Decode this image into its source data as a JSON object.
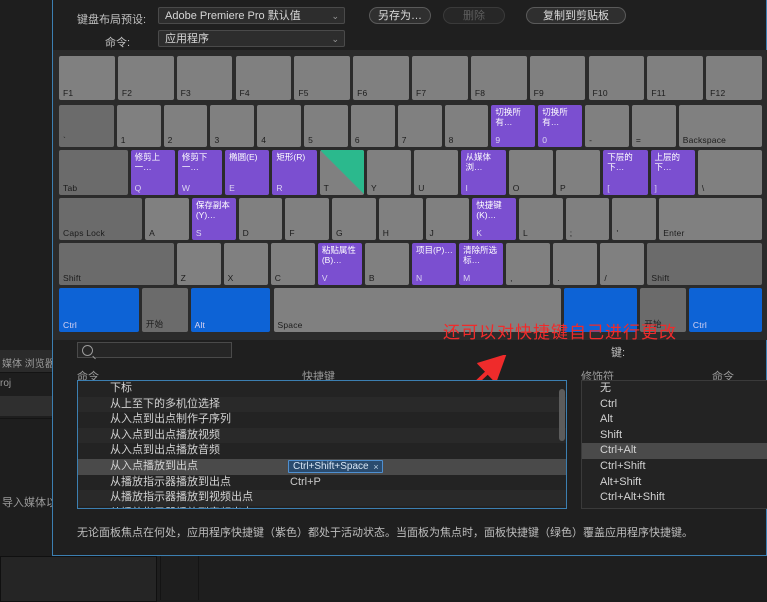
{
  "background": {
    "tabs": [
      "媒体 浏览器"
    ],
    "project_label": "roj",
    "import_hint": "导入媒体以开",
    "effects_label": "媒体 浏览器"
  },
  "dialog": {
    "preset_label": "键盘布局预设:",
    "preset_value": "Adobe Premiere Pro 默认值",
    "save_as_label": "另存为…",
    "delete_label": "删除",
    "copy_clipboard_label": "复制到剪贴板",
    "command_label": "命令:",
    "command_value": "应用程序",
    "caret": "⌄"
  },
  "annotation": {
    "red_text": "还可以对快捷键自己进行更改"
  },
  "keyboard": {
    "function_row": [
      {
        "name": "F1"
      },
      {
        "name": "F2"
      },
      {
        "name": "F3"
      },
      {
        "name": "F4"
      },
      {
        "name": "F5"
      },
      {
        "name": "F6"
      },
      {
        "name": "F7"
      },
      {
        "name": "F8"
      },
      {
        "name": "F9"
      },
      {
        "name": "F10"
      },
      {
        "name": "F11"
      },
      {
        "name": "F12"
      }
    ],
    "number_row": [
      {
        "name": "`",
        "cmd": "",
        "style": "dark"
      },
      {
        "name": "1",
        "cmd": "",
        "style": ""
      },
      {
        "name": "2",
        "cmd": "",
        "style": ""
      },
      {
        "name": "3",
        "cmd": "",
        "style": ""
      },
      {
        "name": "4",
        "cmd": "",
        "style": ""
      },
      {
        "name": "5",
        "cmd": "",
        "style": ""
      },
      {
        "name": "6",
        "cmd": "",
        "style": ""
      },
      {
        "name": "7",
        "cmd": "",
        "style": ""
      },
      {
        "name": "8",
        "cmd": "",
        "style": ""
      },
      {
        "name": "9",
        "cmd": "切换所有…",
        "style": "purple"
      },
      {
        "name": "0",
        "cmd": "切换所有…",
        "style": "purple"
      },
      {
        "name": "-",
        "cmd": "",
        "style": ""
      },
      {
        "name": "=",
        "cmd": "",
        "style": ""
      },
      {
        "name": "Backspace",
        "cmd": "",
        "style": ""
      }
    ],
    "tab_row": [
      {
        "name": "Tab",
        "cmd": "",
        "style": "dark"
      },
      {
        "name": "Q",
        "cmd": "修剪上一…",
        "style": "purple"
      },
      {
        "name": "W",
        "cmd": "修剪下一…",
        "style": "purple"
      },
      {
        "name": "E",
        "cmd": "椭圆(E)",
        "style": "purple"
      },
      {
        "name": "R",
        "cmd": "矩形(R)",
        "style": "purple"
      },
      {
        "name": "T",
        "cmd": "",
        "style": "panel"
      },
      {
        "name": "Y",
        "cmd": "",
        "style": ""
      },
      {
        "name": "U",
        "cmd": "",
        "style": ""
      },
      {
        "name": "I",
        "cmd": "从媒体浏…",
        "style": "purple"
      },
      {
        "name": "O",
        "cmd": "",
        "style": ""
      },
      {
        "name": "P",
        "cmd": "",
        "style": ""
      },
      {
        "name": "[",
        "cmd": "下层的下…",
        "style": "purple"
      },
      {
        "name": "]",
        "cmd": "上层的下…",
        "style": "purple"
      },
      {
        "name": "\\",
        "cmd": "",
        "style": ""
      }
    ],
    "home_row": [
      {
        "name": "Caps Lock",
        "cmd": "",
        "style": "dark"
      },
      {
        "name": "A",
        "cmd": "",
        "style": ""
      },
      {
        "name": "S",
        "cmd": "保存副本(Y)…",
        "style": "purple"
      },
      {
        "name": "D",
        "cmd": "",
        "style": ""
      },
      {
        "name": "F",
        "cmd": "",
        "style": ""
      },
      {
        "name": "G",
        "cmd": "",
        "style": ""
      },
      {
        "name": "H",
        "cmd": "",
        "style": ""
      },
      {
        "name": "J",
        "cmd": "",
        "style": ""
      },
      {
        "name": "K",
        "cmd": "快捷键(K)…",
        "style": "purple"
      },
      {
        "name": "L",
        "cmd": "",
        "style": ""
      },
      {
        "name": ";",
        "cmd": "",
        "style": ""
      },
      {
        "name": "'",
        "cmd": "",
        "style": ""
      },
      {
        "name": "Enter",
        "cmd": "",
        "style": ""
      }
    ],
    "shift_row": [
      {
        "name": "Shift",
        "cmd": "",
        "style": "dark"
      },
      {
        "name": "Z",
        "cmd": "",
        "style": ""
      },
      {
        "name": "X",
        "cmd": "",
        "style": ""
      },
      {
        "name": "C",
        "cmd": "",
        "style": ""
      },
      {
        "name": "V",
        "cmd": "粘贴属性(B)…",
        "style": "purple"
      },
      {
        "name": "B",
        "cmd": "",
        "style": ""
      },
      {
        "name": "N",
        "cmd": "项目(P)…",
        "style": "purple"
      },
      {
        "name": "M",
        "cmd": "清除所选标…",
        "style": "purple"
      },
      {
        "name": ",",
        "cmd": "",
        "style": ""
      },
      {
        "name": ".",
        "cmd": "",
        "style": ""
      },
      {
        "name": "/",
        "cmd": "",
        "style": ""
      },
      {
        "name": "Shift",
        "cmd": "",
        "style": "dark"
      }
    ],
    "bottom_row": [
      {
        "name": "Ctrl",
        "cmd": "",
        "style": "blue"
      },
      {
        "name": "开始",
        "cmd": "",
        "style": "dark"
      },
      {
        "name": "Alt",
        "cmd": "",
        "style": "blue"
      },
      {
        "name": "Space",
        "cmd": "",
        "style": ""
      },
      {
        "name": "",
        "cmd": "",
        "style": "blue"
      },
      {
        "name": "开始",
        "cmd": "",
        "style": "dark"
      },
      {
        "name": "Ctrl",
        "cmd": "",
        "style": "blue"
      }
    ]
  },
  "search": {
    "placeholder": "",
    "value": "",
    "icon": "search-icon"
  },
  "lists": {
    "key_label": "键:",
    "command_header": "命令",
    "shortcut_header": "快捷键",
    "modifier_header": "修饰符",
    "modcommand_header": "命令",
    "commands": [
      {
        "name": "下标",
        "shortcut": "",
        "selected": false
      },
      {
        "name": "从上至下的多机位选择",
        "shortcut": "",
        "selected": false
      },
      {
        "name": "从入点到出点制作子序列",
        "shortcut": "",
        "selected": false
      },
      {
        "name": "从入点到出点播放视频",
        "shortcut": "",
        "selected": false
      },
      {
        "name": "从入点到出点播放音频",
        "shortcut": "",
        "selected": false
      },
      {
        "name": "从入点播放到出点",
        "shortcut": "Ctrl+Shift+Space",
        "selected": true
      },
      {
        "name": "从播放指示器播放到出点",
        "shortcut": "Ctrl+P",
        "selected": false
      },
      {
        "name": "从播放指示器播放到视频出点",
        "shortcut": "",
        "selected": false
      },
      {
        "name": "从播放指示器播放到音频出点",
        "shortcut": "",
        "selected": false
      }
    ],
    "chip_remove": "×",
    "modifiers": [
      {
        "label": "无",
        "selected": false
      },
      {
        "label": "Ctrl",
        "selected": false
      },
      {
        "label": "Alt",
        "selected": false
      },
      {
        "label": "Shift",
        "selected": false
      },
      {
        "label": "Ctrl+Alt",
        "selected": true
      },
      {
        "label": "Ctrl+Shift",
        "selected": false
      },
      {
        "label": "Alt+Shift",
        "selected": false
      },
      {
        "label": "Ctrl+Alt+Shift",
        "selected": false
      }
    ]
  },
  "footer": {
    "note": "无论面板焦点在何处，应用程序快捷键（紫色）都处于活动状态。当面板为焦点时，面板快捷键（绿色）覆盖应用程序快捷键。"
  },
  "colors": {
    "app_shortcut": "#7b4fd0",
    "panel_shortcut": "#2bb98d",
    "modifier_key": "#0d63d6",
    "accent_border": "#3c7fb1",
    "annotation_red": "#ef2b2b"
  }
}
